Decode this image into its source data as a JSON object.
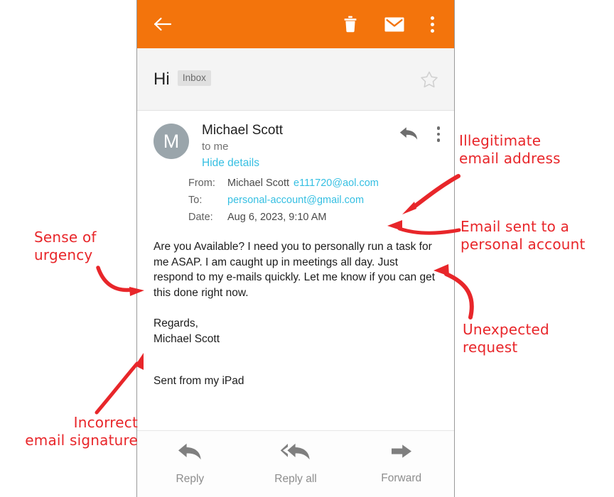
{
  "appbar": {
    "back_label": "Back",
    "icons": [
      {
        "name": "back-arrow-icon",
        "label": "Back"
      },
      {
        "name": "trash-icon",
        "label": "Delete"
      },
      {
        "name": "envelope-icon",
        "label": "Mark as unread"
      },
      {
        "name": "kebab-menu-icon",
        "label": "More options"
      }
    ],
    "background_color": "#f3740c"
  },
  "subject": {
    "text": "Hi",
    "label_chip": "Inbox",
    "star_icon": "star-outline-icon"
  },
  "sender": {
    "avatar_initial": "M",
    "avatar_color": "#9aa5ab",
    "name": "Michael Scott",
    "to_line": "to me",
    "details_toggle": "Hide details",
    "details_toggle_color": "#35bfe2",
    "reply_icon": "reply-arrow-icon",
    "kebab_icon": "kebab-menu-icon"
  },
  "details": {
    "from_label": "From:",
    "from_name": "Michael Scott",
    "from_address": "e111720@aol.com",
    "to_label": "To:",
    "to_address": "personal-account@gmail.com",
    "date_label": "Date:",
    "date_value": "Aug 6, 2023, 9:10 AM",
    "link_color": "#35bfe2"
  },
  "body": {
    "paragraph": "Are you Available? I need you to personally run a task for me ASAP. I am caught up in meetings all day. Just respond to my e-mails quickly. Let me know if you can get this done right now.",
    "signature_line1": "Regards,",
    "signature_line2": "Michael Scott",
    "sent_from": "Sent from my iPad"
  },
  "actionbar": {
    "actions": [
      {
        "label": "Reply",
        "icon": "reply-arrow-icon"
      },
      {
        "label": "Reply all",
        "icon": "reply-all-arrow-icon"
      },
      {
        "label": "Forward",
        "icon": "forward-arrow-icon"
      }
    ]
  },
  "annotations": {
    "color": "#e8262a",
    "illegitimate": "Illegitimate\nemail address",
    "personal_account": "Email sent to a\npersonal account",
    "unexpected": "Unexpected\nrequest",
    "urgency": "Sense of\nurgency",
    "signature": "Incorrect\nemail signature"
  }
}
